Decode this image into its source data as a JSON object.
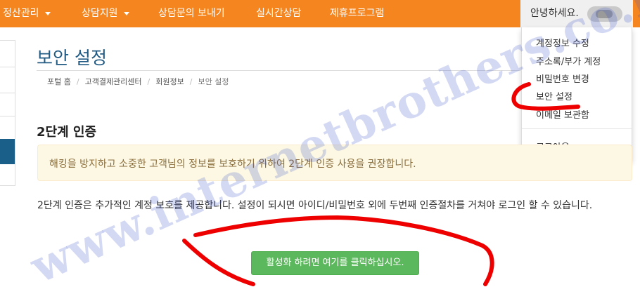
{
  "topnav": {
    "items": [
      {
        "label": "정산관리",
        "has_caret": true
      },
      {
        "label": "상담지원",
        "has_caret": true
      },
      {
        "label": "상담문의 보내기",
        "has_caret": false
      },
      {
        "label": "실시간상담",
        "has_caret": false
      },
      {
        "label": "제휴프로그램",
        "has_caret": false
      }
    ],
    "greeting": "안녕하세요.",
    "accent_color": "#f5851f"
  },
  "user_menu": {
    "items": [
      "계정정보 수정",
      "주소록/부가 계정",
      "비밀번호 변경",
      "보안 설정",
      "이메일 보관함"
    ],
    "logout": "로그아웃"
  },
  "page": {
    "title": "보안 설정",
    "breadcrumb": [
      "포털 홈",
      "고객결제관리센터",
      "회원정보",
      "보안 설정"
    ]
  },
  "two_factor": {
    "title": "2단계 인증",
    "alert": "해킹을 방지하고 소중한 고객님의 정보를 보호하기 위하여 2단계 인증 사용을 권장합니다.",
    "description": "2단계 인증은 추가적인 계정 보호를 제공합니다. 설정이 되시면 아이디/비밀번호 외에 두번째 인증절차를 거쳐야 로그인 할 수 있습니다.",
    "activate_button": "활성화 하려면 여기를 클릭하십시오.",
    "button_color": "#5cb85c"
  },
  "watermark": "www.internetbrothers.co.kr"
}
